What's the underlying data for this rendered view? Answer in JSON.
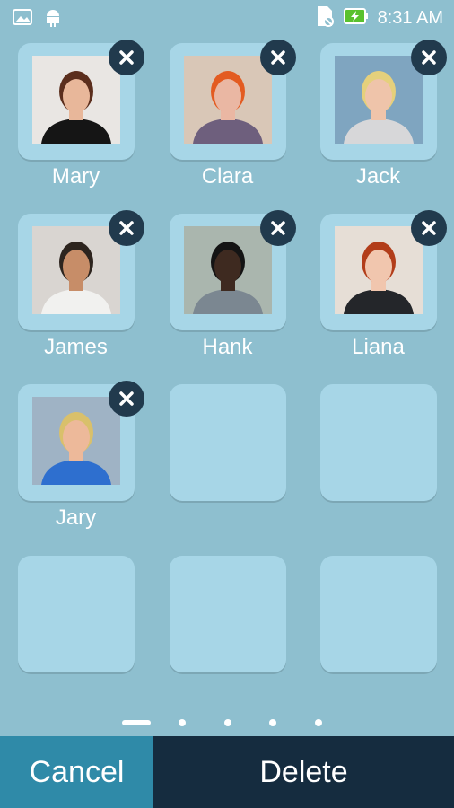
{
  "status_bar": {
    "time": "8:31 AM"
  },
  "contacts": [
    {
      "name": "Mary",
      "bg": "#e9e6e3",
      "skin": "#e8b79a",
      "hair": "#5b2e1d",
      "shirt": "#151515"
    },
    {
      "name": "Clara",
      "bg": "#d9c7b7",
      "skin": "#eab7a3",
      "hair": "#e35b21",
      "shirt": "#6e5f7d"
    },
    {
      "name": "Jack",
      "bg": "#7fa5c0",
      "skin": "#efc4aa",
      "hair": "#e5d07c",
      "shirt": "#d7d7d9"
    },
    {
      "name": "James",
      "bg": "#d9d5d1",
      "skin": "#c78d68",
      "hair": "#2d241e",
      "shirt": "#f1f1ef"
    },
    {
      "name": "Hank",
      "bg": "#aab6ae",
      "skin": "#3e2a20",
      "hair": "#141414",
      "shirt": "#7b8791"
    },
    {
      "name": "Liana",
      "bg": "#e6ded6",
      "skin": "#f1c6ae",
      "hair": "#b23d1a",
      "shirt": "#24262a"
    },
    {
      "name": "Jary",
      "bg": "#9fb3c5",
      "skin": "#edb99a",
      "hair": "#d9c06b",
      "shirt": "#2e6fcf"
    }
  ],
  "buttons": {
    "cancel": "Cancel",
    "delete": "Delete"
  },
  "pager": {
    "pages": 5,
    "current": 1
  }
}
